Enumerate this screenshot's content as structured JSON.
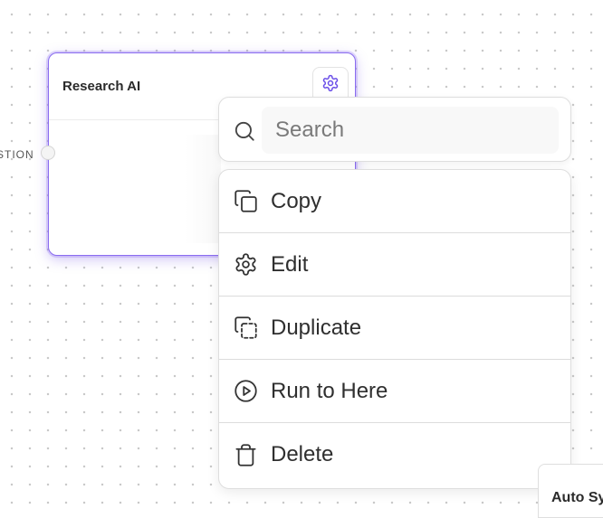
{
  "node": {
    "title": "Research AI",
    "input_port_label": "STION",
    "settings_icon": "gear-icon",
    "accent_color": "#8a6cf0"
  },
  "context_menu": {
    "search": {
      "placeholder": "Search",
      "icon": "search-icon"
    },
    "items": [
      {
        "label": "Copy",
        "icon": "copy-icon"
      },
      {
        "label": "Edit",
        "icon": "gear-icon"
      },
      {
        "label": "Duplicate",
        "icon": "duplicate-icon"
      },
      {
        "label": "Run to Here",
        "icon": "play-circle-icon"
      },
      {
        "label": "Delete",
        "icon": "trash-icon"
      }
    ]
  },
  "auto_sync": {
    "label": "Auto Sy"
  }
}
